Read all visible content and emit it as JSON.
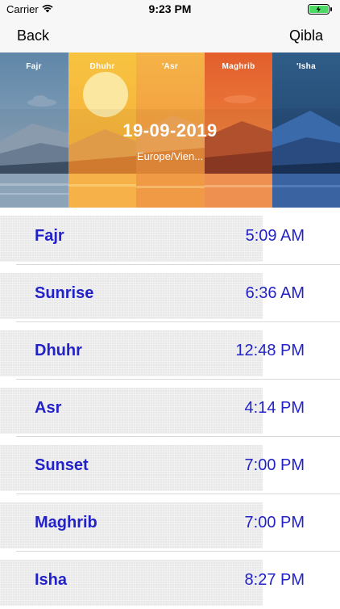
{
  "status_bar": {
    "carrier": "Carrier",
    "time": "9:23 PM",
    "wifi_icon": "wifi-icon",
    "battery_icon": "battery-charging-icon"
  },
  "nav": {
    "back_label": "Back",
    "qibla_label": "Qibla"
  },
  "banner": {
    "prayers": [
      "Fajr",
      "Dhuhr",
      "'Asr",
      "Maghrib",
      "'Isha"
    ],
    "date": "19-09-2019",
    "timezone": "Europe/Vien..."
  },
  "times": [
    {
      "name": "Fajr",
      "time": "5:09 AM"
    },
    {
      "name": "Sunrise",
      "time": "6:36 AM"
    },
    {
      "name": "Dhuhr",
      "time": "12:48 PM"
    },
    {
      "name": "Asr",
      "time": "4:14 PM"
    },
    {
      "name": "Sunset",
      "time": "7:00 PM"
    },
    {
      "name": "Maghrib",
      "time": "7:00 PM"
    },
    {
      "name": "Isha",
      "time": "8:27 PM"
    }
  ],
  "colors": {
    "accent": "#2222c8",
    "bar_bg": "#f7f7f7"
  }
}
